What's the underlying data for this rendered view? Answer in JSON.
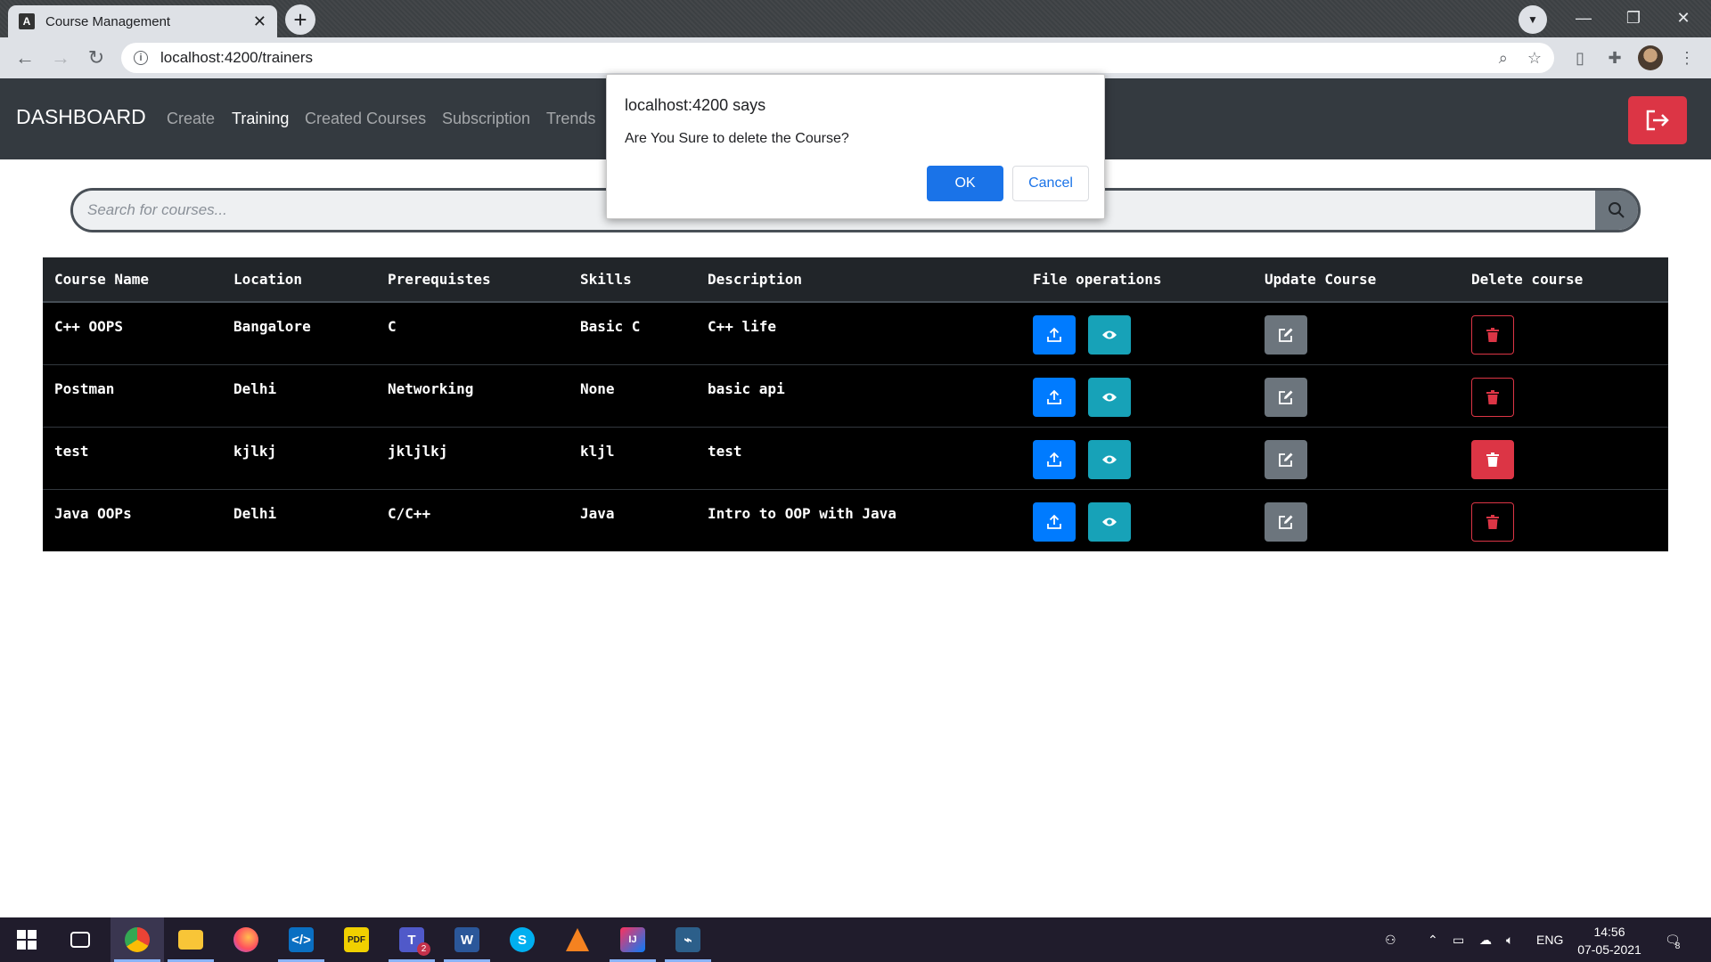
{
  "browser": {
    "tab_title": "Course Management",
    "tab_favicon": "A",
    "new_tab_label": "+",
    "url": "localhost:4200/trainers"
  },
  "nav": {
    "brand": "DASHBOARD",
    "links": [
      "Create",
      "Training",
      "Created Courses",
      "Subscription",
      "Trends"
    ],
    "active_link": "Training"
  },
  "search": {
    "placeholder": "Search for courses..."
  },
  "table": {
    "headers": [
      "Course Name",
      "Location",
      "Prerequistes",
      "Skills",
      "Description",
      "File operations",
      "Update Course",
      "Delete course"
    ],
    "rows": [
      {
        "name": "C++ OOPS",
        "location": "Bangalore",
        "prereq": "C",
        "skills": "Basic C",
        "description": "C++ life"
      },
      {
        "name": "Postman",
        "location": "Delhi",
        "prereq": "Networking",
        "skills": "None",
        "description": "basic api"
      },
      {
        "name": "test",
        "location": "kjlkj",
        "prereq": "jkljlkj",
        "skills": "kljl",
        "description": "test"
      },
      {
        "name": "Java OOPs",
        "location": "Delhi",
        "prereq": "C/C++",
        "skills": "Java",
        "description": "Intro to OOP with Java"
      }
    ]
  },
  "dialog": {
    "title": "localhost:4200 says",
    "message": "Are You Sure to delete the Course?",
    "ok_label": "OK",
    "cancel_label": "Cancel"
  },
  "taskbar": {
    "language": "ENG",
    "time": "14:56",
    "date": "07-05-2021",
    "notification_count": "8",
    "teams_badge": "2"
  },
  "colors": {
    "navbar": "#343a40",
    "danger": "#dc3545",
    "primary": "#007bff",
    "info": "#17a2b8",
    "secondary": "#6c757d",
    "dialog_button": "#1a73e8"
  }
}
